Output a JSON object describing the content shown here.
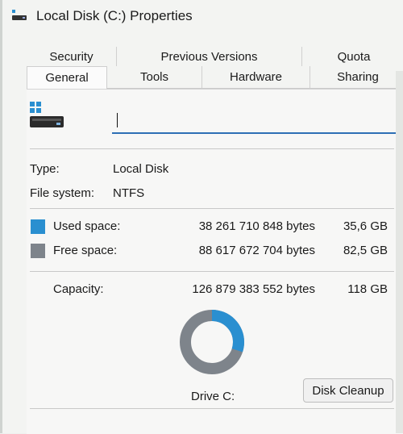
{
  "window": {
    "title": "Local Disk (C:) Properties"
  },
  "tabs": {
    "row1": [
      "Security",
      "Previous Versions",
      "Quota"
    ],
    "row2": [
      "General",
      "Tools",
      "Hardware",
      "Sharing"
    ],
    "active": "General"
  },
  "general": {
    "name_value": "",
    "type_label": "Type:",
    "type_value": "Local Disk",
    "fs_label": "File system:",
    "fs_value": "NTFS",
    "used_label": "Used space:",
    "used_bytes": "38 261 710 848 bytes",
    "used_gb": "35,6 GB",
    "free_label": "Free space:",
    "free_bytes": "88 617 672 704 bytes",
    "free_gb": "82,5 GB",
    "cap_label": "Capacity:",
    "cap_bytes": "126 879 383 552 bytes",
    "cap_gb": "118 GB",
    "drive_label": "Drive C:",
    "cleanup_label": "Disk Cleanup",
    "used_fraction": 0.3
  },
  "colors": {
    "used": "#2a8fd0",
    "free": "#7e848b",
    "accent": "#2d6fb5"
  },
  "icons": {
    "title": "drive-icon",
    "drive": "windows-drive-icon"
  }
}
